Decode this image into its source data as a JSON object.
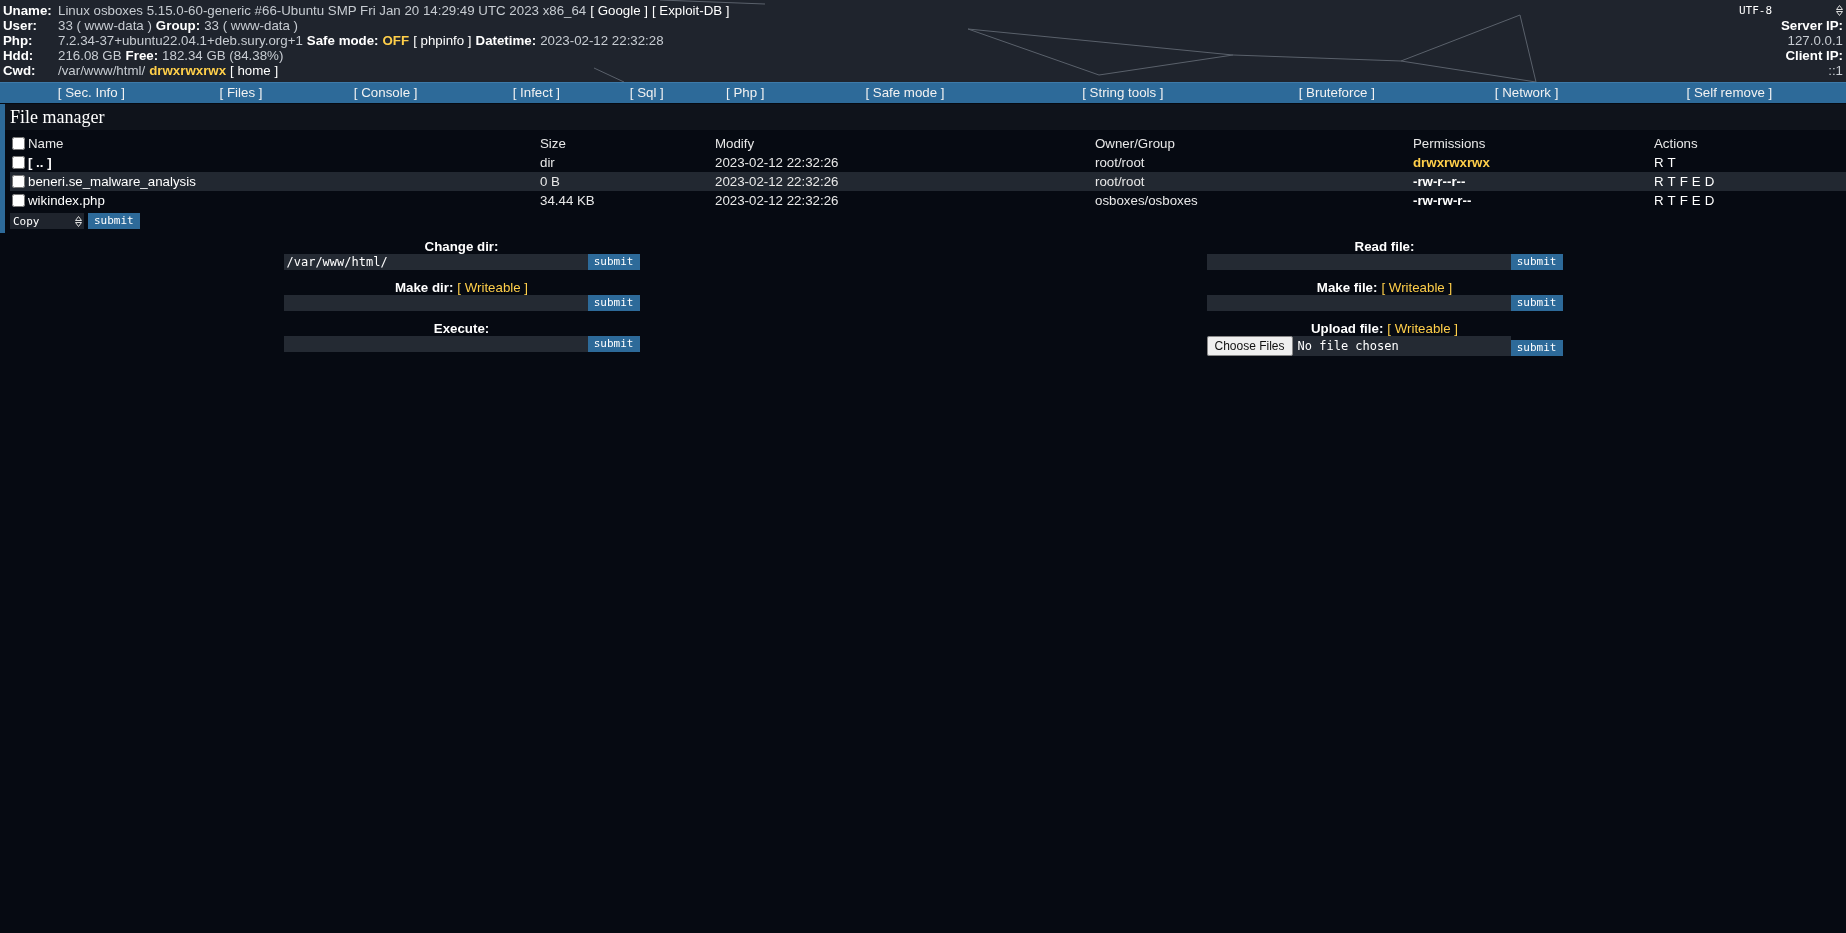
{
  "header": {
    "info_rows": [
      {
        "label": "Uname:",
        "parts": [
          {
            "kind": "text",
            "text": "Linux osboxes 5.15.0-60-generic #66-Ubuntu SMP Fri Jan 20 14:29:49 UTC 2023 x86_64"
          },
          {
            "kind": "link",
            "text": "[ Google ]"
          },
          {
            "kind": "link",
            "text": "[ Exploit-DB ]"
          }
        ]
      },
      {
        "label": "User:",
        "parts": [
          {
            "kind": "text",
            "text": "33 ( www-data )"
          },
          {
            "kind": "label",
            "text": "Group:"
          },
          {
            "kind": "text",
            "text": "33 ( www-data )"
          }
        ]
      },
      {
        "label": "Php:",
        "parts": [
          {
            "kind": "text",
            "text": "7.2.34-37+ubuntu22.04.1+deb.sury.org+1"
          },
          {
            "kind": "label",
            "text": "Safe mode:"
          },
          {
            "kind": "highlight",
            "text": "OFF"
          },
          {
            "kind": "link",
            "text": "[ phpinfo ]"
          },
          {
            "kind": "label",
            "text": "Datetime:"
          },
          {
            "kind": "text",
            "text": "2023-02-12 22:32:28"
          }
        ]
      },
      {
        "label": "Hdd:",
        "parts": [
          {
            "kind": "text",
            "text": "216.08 GB"
          },
          {
            "kind": "label",
            "text": "Free:"
          },
          {
            "kind": "text",
            "text": "182.34 GB (84.38%)"
          }
        ]
      },
      {
        "label": "Cwd:",
        "parts": [
          {
            "kind": "text",
            "text": "/var/www/html/"
          },
          {
            "kind": "highlight",
            "text": "drwxrwxrwx"
          },
          {
            "kind": "link",
            "text": "[ home ]"
          }
        ]
      }
    ],
    "charset": "UTF-8",
    "server_ip_label": "Server IP:",
    "server_ip": "127.0.0.1",
    "client_ip_label": "Client IP:",
    "client_ip": "::1"
  },
  "nav": [
    "[ Sec. Info ]",
    "[ Files ]",
    "[ Console ]",
    "[ Infect ]",
    "[ Sql ]",
    "[ Php ]",
    "[ Safe mode ]",
    "[ String tools ]",
    "[ Bruteforce ]",
    "[ Network ]",
    "[ Self remove ]"
  ],
  "file_manager": {
    "title": "File manager",
    "select_all_checked": false,
    "columns": [
      "Name",
      "Size",
      "Modify",
      "Owner/Group",
      "Permissions",
      "Actions"
    ],
    "rows": [
      {
        "kind": "parent",
        "checked": false,
        "highlighted": false,
        "name": "[ .. ]",
        "size": "dir",
        "modify": "2023-02-12 22:32:26",
        "owner": "root/root",
        "permissions": "drwxrwxrwx",
        "writable": true,
        "actions": [
          "R",
          "T"
        ]
      },
      {
        "kind": "file",
        "checked": false,
        "highlighted": true,
        "name": "beneri.se_malware_analysis",
        "size": "0 B",
        "modify": "2023-02-12 22:32:26",
        "owner": "root/root",
        "permissions": "-rw-r--r--",
        "writable": false,
        "actions": [
          "R",
          "T",
          "F",
          "E",
          "D"
        ]
      },
      {
        "kind": "file",
        "checked": false,
        "highlighted": false,
        "name": "wikindex.php",
        "size": "34.44 KB",
        "modify": "2023-02-12 22:32:26",
        "owner": "osboxes/osboxes",
        "permissions": "-rw-rw-r--",
        "writable": false,
        "actions": [
          "R",
          "T",
          "F",
          "E",
          "D"
        ]
      }
    ],
    "bulk_action": "Copy",
    "bulk_button": "submit"
  },
  "forms": [
    [
      {
        "kind": "text",
        "label": "Change dir:",
        "input": {
          "value": "/var/www/html/"
        },
        "button": "submit"
      },
      {
        "kind": "text",
        "label": "Make dir:",
        "note": "[ Writeable ]",
        "button": "submit"
      },
      {
        "kind": "text",
        "label": "Execute:",
        "button": "submit"
      }
    ],
    [
      {
        "kind": "text",
        "label": "Read file:",
        "button": "submit"
      },
      {
        "kind": "text",
        "label": "Make file:",
        "note": "[ Writeable ]",
        "button": "submit"
      },
      {
        "kind": "file",
        "label": "Upload file:",
        "note": "[ Writeable ]",
        "file_button": "Choose Files",
        "file_status": "No file chosen",
        "button": "submit"
      }
    ]
  ]
}
